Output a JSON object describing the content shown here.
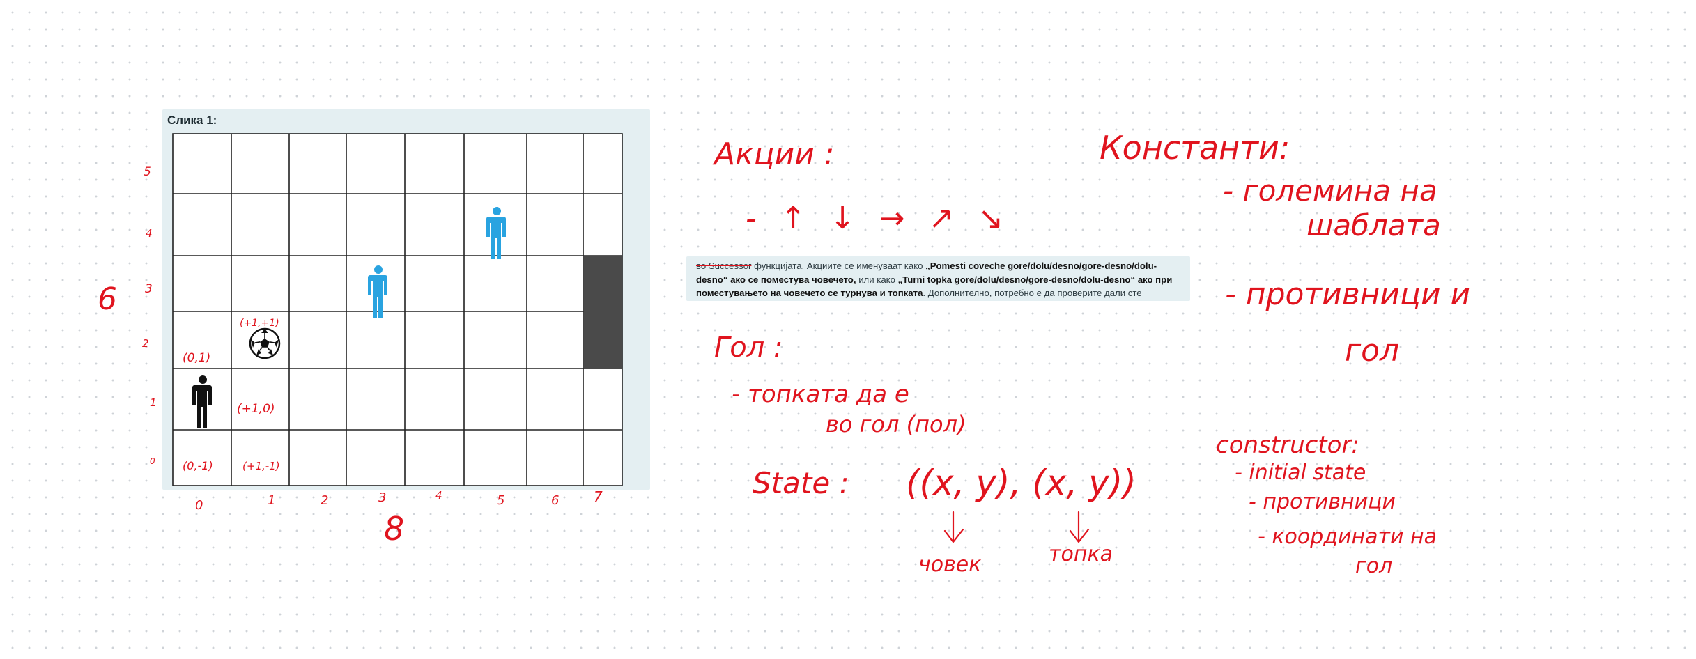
{
  "figure": {
    "title": "Слика 1:",
    "columns": 8,
    "rows": 6,
    "pieces": {
      "ball": "soccer-ball-icon",
      "player": "black-person-icon",
      "opponents": "blue-person-icon",
      "goal": "dark-goal-cells"
    },
    "colors": {
      "opponent": "#29a3e0",
      "goal": "#4a4a4a",
      "player": "#111111"
    }
  },
  "snippet": {
    "prefix_struck": "во Successor",
    "prefix_plain": " функцијата. Акциите се именуваат како ",
    "quote1": "„Pomesti coveche gore/dolu/desno/gore-desno/dolu-desno“ ако се поместува човечето,",
    "mid": " или како ",
    "quote2": "„Turni topka gore/dolu/desno/gore-desno/dolu-desno“ ако при поместувањето на човечето се турнува и топката",
    "suffix_plain": ". ",
    "suffix_struck": "Дополнително, потребно е да проверите дали сте"
  },
  "annotations": {
    "row_labels": [
      "5",
      "4",
      "3",
      "2",
      "1",
      "0"
    ],
    "col_labels": [
      "0",
      "1",
      "2",
      "3",
      "4",
      "5",
      "6",
      "7"
    ],
    "rows_total": "6",
    "cols_total": "8",
    "cell_labels": {
      "c0r2": "(0,1)",
      "c1r3": "(+1,+1)",
      "c1r1": "(+1,0)",
      "c0r0": "(0,-1)",
      "c1r0": "(+1,-1)"
    },
    "actions_title": "Акции :",
    "actions_arrows": "-  ↑ ↓  →  ↗  ↘",
    "goal_title": "Гол :",
    "goal_line1": "- топката да е",
    "goal_line2": "во гол (пол)",
    "state_label": "State :",
    "state_tuple": "((x, y), (x, y))",
    "state_person": "човек",
    "state_ball": "топка",
    "constants_title": "Константи:",
    "constants_item1_line1": "- големина на",
    "constants_item1_line2": "шаблата",
    "constants_item2_line1": "- противници и",
    "constants_item2_line2": "гол",
    "constructor_title": "constructor:",
    "constructor_item1": "- initial state",
    "constructor_item2": "- противници",
    "constructor_item3_line1": "- координати на",
    "constructor_item3_line2": "гол",
    "ink_color": "#e0141e"
  }
}
